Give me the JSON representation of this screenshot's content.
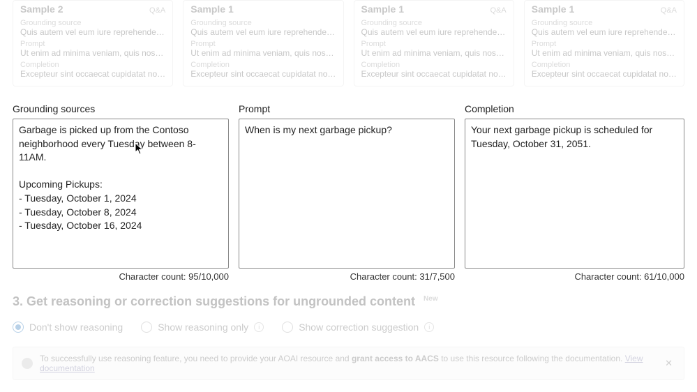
{
  "samples": [
    {
      "title": "Sample 2",
      "tag": "Q&A",
      "grounding_label": "Grounding source",
      "grounding_value": "Quis autem vel eum iure reprehenderit...",
      "prompt_label": "Prompt",
      "prompt_value": "Ut enim ad minima veniam, quis nostru...",
      "completion_label": "Completion",
      "completion_value": "Excepteur sint occaecat cupidatat non p..."
    },
    {
      "title": "Sample 1",
      "tag": "",
      "grounding_label": "Grounding source",
      "grounding_value": "Quis autem vel eum iure reprehenderit...",
      "prompt_label": "Prompt",
      "prompt_value": "Ut enim ad minima veniam, quis nostru...",
      "completion_label": "Completion",
      "completion_value": "Excepteur sint occaecat cupidatat non p..."
    },
    {
      "title": "Sample 1",
      "tag": "Q&A",
      "grounding_label": "Grounding source",
      "grounding_value": "Quis autem vel eum iure reprehenderit...",
      "prompt_label": "Prompt",
      "prompt_value": "Ut enim ad minima veniam, quis nostru...",
      "completion_label": "Completion",
      "completion_value": "Excepteur sint occaecat cupidatat non p..."
    },
    {
      "title": "Sample 1",
      "tag": "Q&A",
      "grounding_label": "Grounding source",
      "grounding_value": "Quis autem vel eum iure reprehenderit...",
      "prompt_label": "Prompt",
      "prompt_value": "Ut enim ad minima veniam, quis nostru...",
      "completion_label": "Completion",
      "completion_value": "Excepteur sint occaecat cupidatat non p..."
    }
  ],
  "editor": {
    "grounding": {
      "header": "Grounding sources",
      "text": "Garbage is picked up from the Contoso neighborhood every Tuesday between 8-11AM.\n\nUpcoming Pickups:\n- Tuesday, October 1, 2024\n- Tuesday, October 8, 2024\n- Tuesday, October 16, 2024",
      "count_label": "Character count: 95/10,000"
    },
    "prompt": {
      "header": "Prompt",
      "text": "When is my next garbage pickup?",
      "count_label": "Character count: 31/7,500"
    },
    "completion": {
      "header": "Completion",
      "text": "Your next garbage pickup is scheduled for Tuesday, October 31, 2051.",
      "count_label": "Character count: 61/10,000"
    }
  },
  "step3": {
    "title": "3. Get reasoning or correction suggestions for ungrounded content",
    "badge": "New",
    "options": {
      "dont_show": "Don't show reasoning",
      "reasoning_only": "Show reasoning only",
      "correction": "Show correction suggestion"
    },
    "info_glyph": "i",
    "banner": {
      "text_prefix": "To successfully use reasoning feature, you need to provide your AOAI resource and ",
      "text_bold": "grant access to AACS",
      "text_suffix": " to use this resource following the documentation. ",
      "link": "View documentation",
      "close": "✕"
    }
  }
}
